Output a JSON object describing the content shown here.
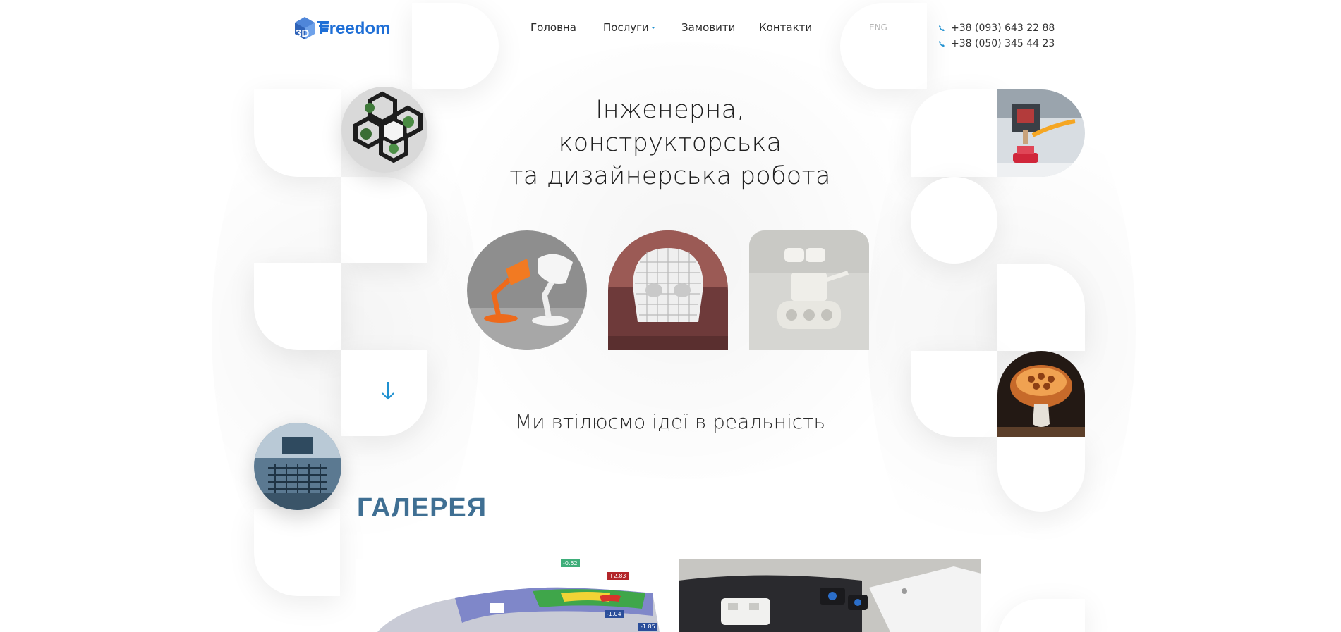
{
  "brand": {
    "logo_prefix": "3D",
    "logo_word": "Freedom",
    "accent": "#1e90d0",
    "logo_blue": "#1f6fd6"
  },
  "nav": {
    "items": [
      {
        "label": "Головна"
      },
      {
        "label": "Послуги",
        "has_dropdown": true
      },
      {
        "label": "Замовити"
      },
      {
        "label": "Контакти"
      }
    ],
    "lang": "ENG"
  },
  "contacts": {
    "phones": [
      "+38 (093) 643 22 88",
      "+38 (050) 345 44 23"
    ]
  },
  "hero": {
    "title_lines": [
      "Інженерна,",
      "конструкторська",
      "та дизайнерська робота"
    ],
    "tagline": "Ми втілюємо ідеї в реальність"
  },
  "gallery": {
    "title": "ГАЛЕРЕЯ",
    "cad_badges": [
      "-0.52",
      "+2.83",
      "-1.04",
      "-1.85"
    ]
  },
  "colors": {
    "heading_blue": "#3f6f93",
    "text": "#222222",
    "muted": "#b5b5b5"
  }
}
